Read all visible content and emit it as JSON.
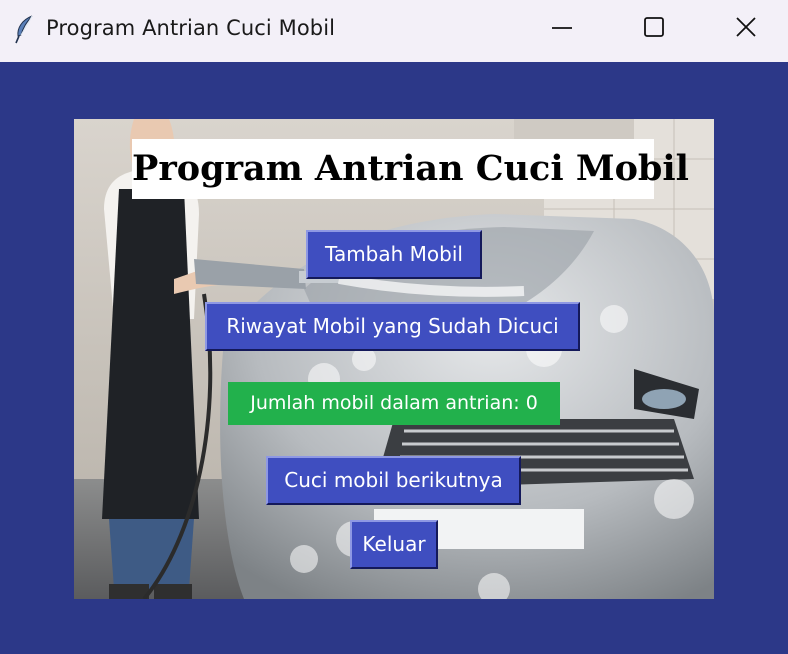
{
  "window": {
    "title": "Program Antrian Cuci Mobil",
    "app_icon": "feather-icon",
    "controls": [
      "minimize-icon",
      "maximize-icon",
      "close-icon"
    ]
  },
  "main": {
    "heading": "Program Antrian Cuci Mobil",
    "buttons": {
      "tambah": "Tambah Mobil",
      "riwayat": "Riwayat Mobil yang Sudah Dicuci",
      "cuci": "Cuci mobil berikutnya",
      "keluar": "Keluar"
    },
    "queue_label": "Jumlah mobil dalam antrian: 0"
  },
  "colors": {
    "window_background": "#2c3888",
    "button": "#3f4ec0",
    "counter": "#22b14c",
    "heading_bg": "#ffffff"
  }
}
